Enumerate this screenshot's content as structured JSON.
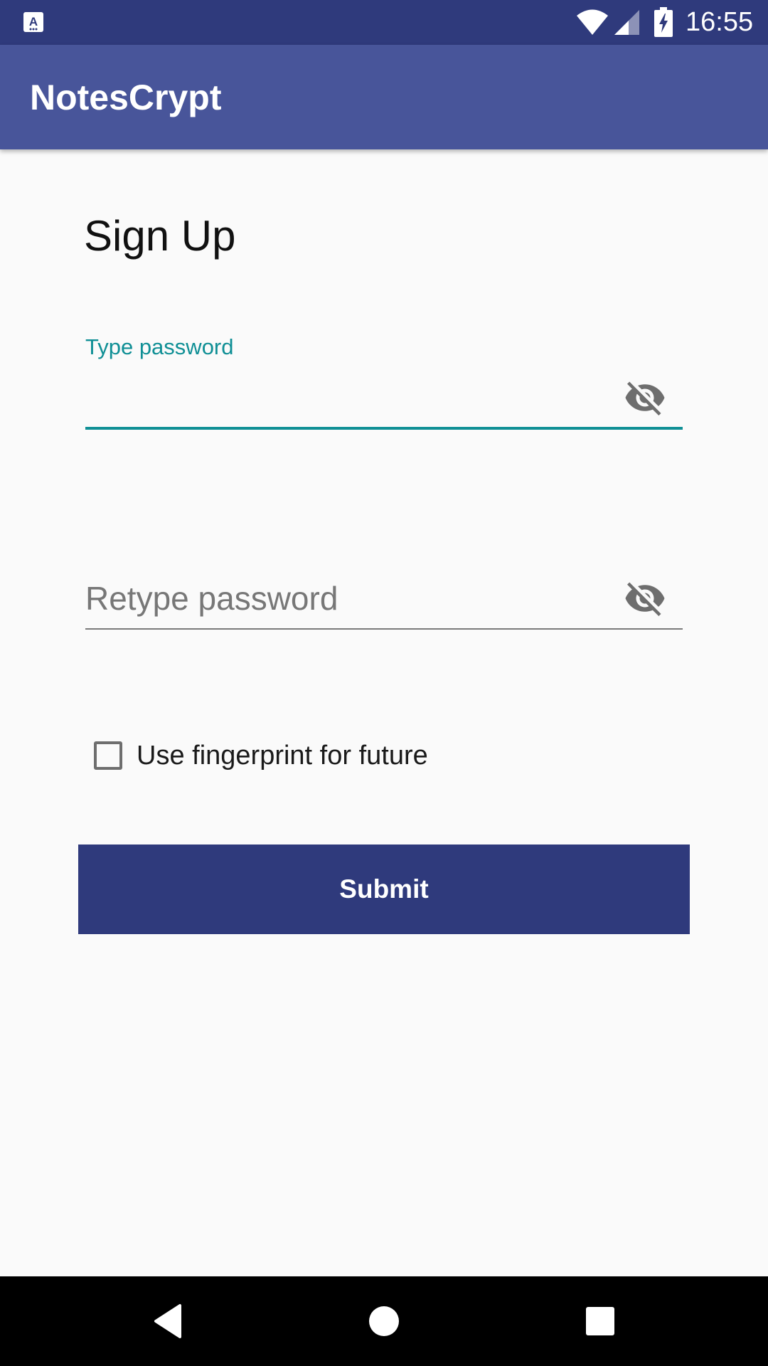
{
  "status_bar": {
    "time": "16:55",
    "app_icon_letter": "A",
    "icons": [
      "notification-app-icon",
      "wifi-icon",
      "cellular-signal-icon",
      "battery-charging-icon"
    ],
    "background_color": "#2f3a7c"
  },
  "app_bar": {
    "title": "NotesCrypt",
    "background_color": "#48559a"
  },
  "form": {
    "title": "Sign Up",
    "password_field": {
      "label": "Type password",
      "value": "",
      "toggle_icon": "visibility-off-icon"
    },
    "retype_field": {
      "placeholder": "Retype password",
      "value": "",
      "toggle_icon": "visibility-off-icon"
    },
    "fingerprint_checkbox": {
      "label": "Use fingerprint for future",
      "checked": false
    },
    "submit_label": "Submit",
    "accent_color": "#0f8f95",
    "button_color": "#2f3a7c"
  },
  "nav_bar": {
    "buttons": [
      "back-icon",
      "home-icon",
      "recents-icon"
    ]
  }
}
